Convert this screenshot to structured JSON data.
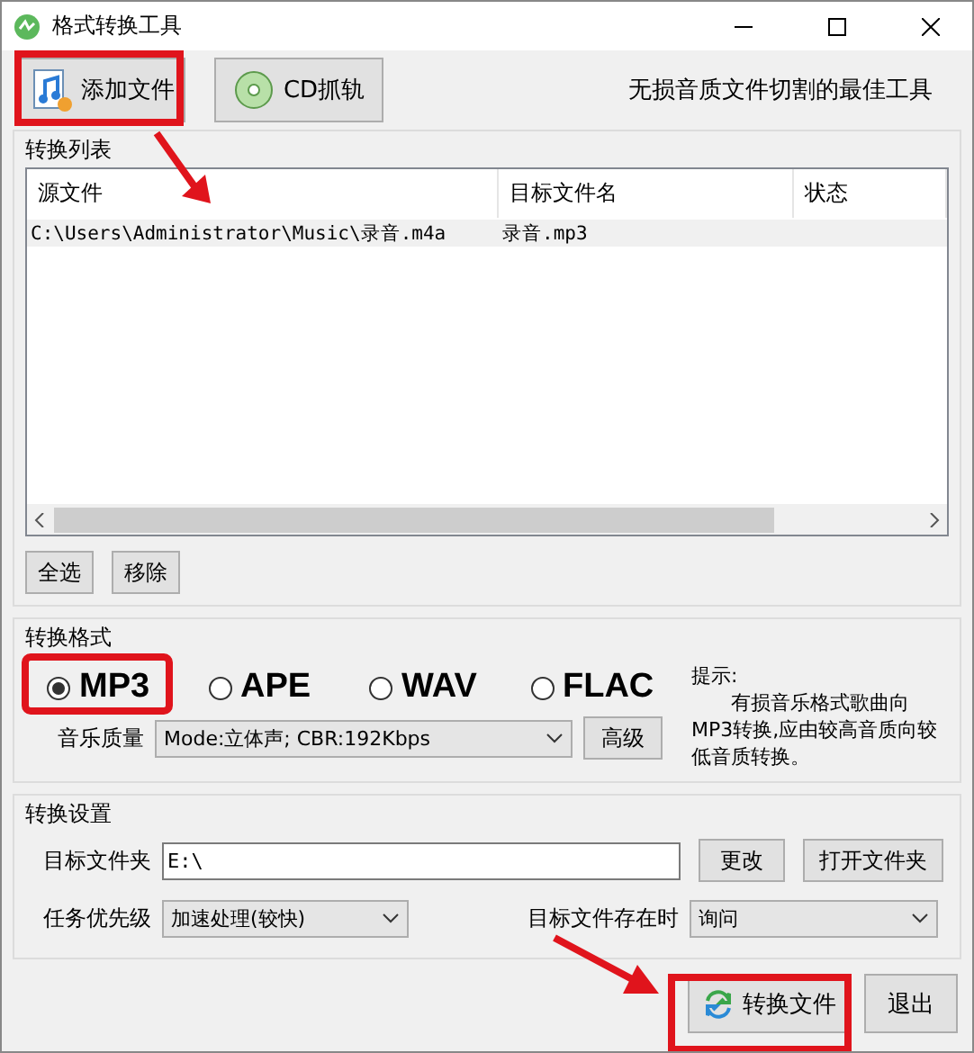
{
  "window": {
    "title": "格式转换工具"
  },
  "toolbar": {
    "buttons": [
      {
        "kind": "add",
        "label": "添加文件"
      },
      {
        "kind": "cd",
        "label": "CD抓轨"
      }
    ],
    "slogan": "无损音质文件切割的最佳工具"
  },
  "conversion_list": {
    "title": "转换列表",
    "columns": [
      "源文件",
      "目标文件名",
      "状态"
    ],
    "rows": [
      [
        "C:\\Users\\Administrator\\Music\\录音.m4a",
        "录音.mp3"
      ]
    ],
    "buttons": [
      "全选",
      "移除"
    ]
  },
  "format": {
    "title": "转换格式",
    "options": [
      {
        "label": "MP3",
        "selected": true
      },
      {
        "label": "APE",
        "selected": false
      },
      {
        "label": "WAV",
        "selected": false
      },
      {
        "label": "FLAC",
        "selected": false
      }
    ],
    "quality_label": "音乐质量",
    "quality": "Mode:立体声; CBR:192Kbps",
    "advanced_button": "高级",
    "hint_title": "提示:",
    "hint": "有损音乐格式歌曲向MP3转换,应由较高音质向较低音质转换。"
  },
  "settings": {
    "title": "转换设置",
    "folder_label": "目标文件夹",
    "folder": "E:\\",
    "change_button": "更改",
    "open_button": "打开文件夹",
    "priority_label": "任务优先级",
    "priority": "加速处理(较快)",
    "exists_label": "目标文件存在时",
    "exists": "询问"
  },
  "actions": [
    {
      "kind": "convert",
      "label": "转换文件"
    },
    {
      "kind": "exit",
      "label": "退出"
    }
  ]
}
